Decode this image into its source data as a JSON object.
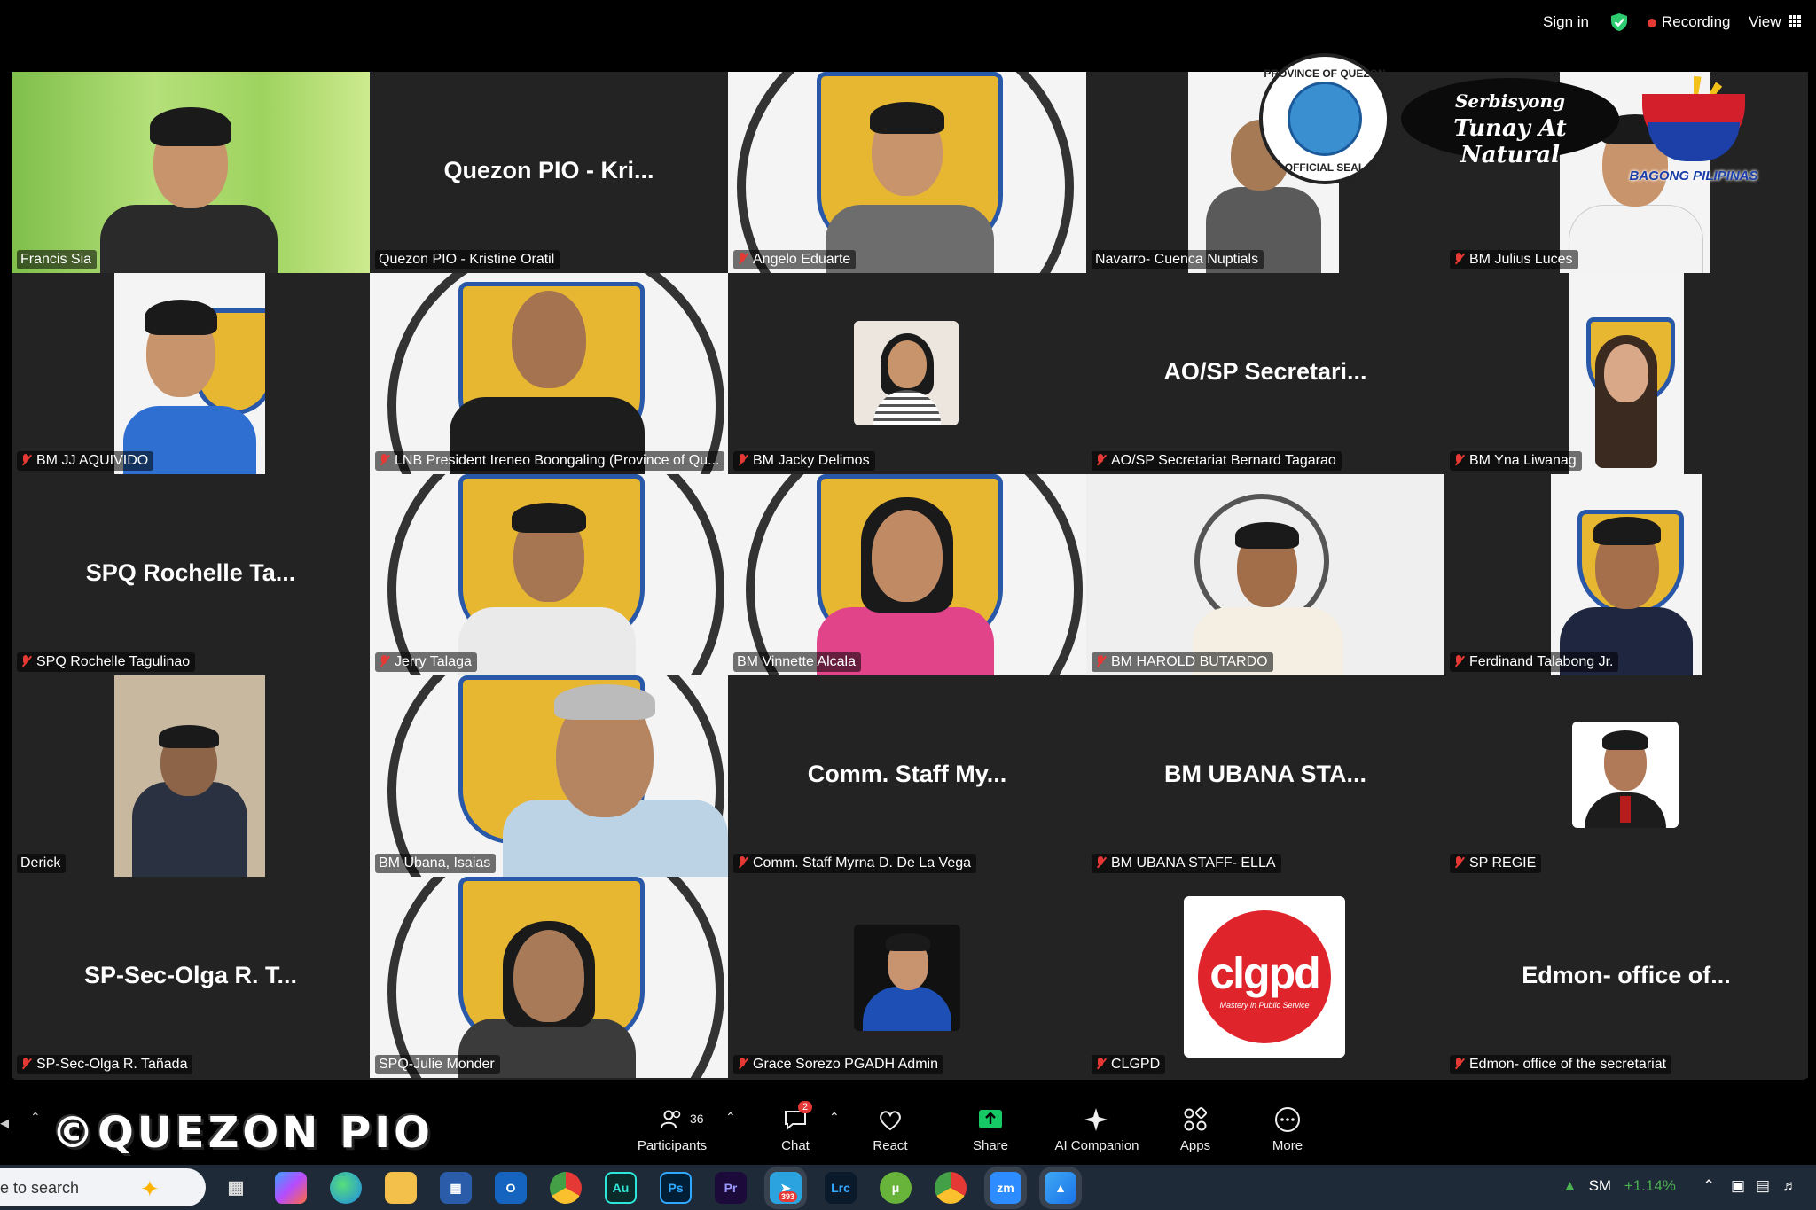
{
  "topbar": {
    "sign_in": "Sign in",
    "recording": "Recording",
    "view": "View"
  },
  "tiles": [
    {
      "label": "Francis Sia",
      "muted": false,
      "display": "video"
    },
    {
      "label": "Quezon PIO - Kristine Oratil",
      "big_name": "Quezon PIO - Kri...",
      "muted": false,
      "display": "name"
    },
    {
      "label": "Angelo Eduarte",
      "muted": true,
      "display": "video"
    },
    {
      "label": "Navarro- Cuenca Nuptials",
      "muted": false,
      "display": "video"
    },
    {
      "label": "BM Julius Luces",
      "muted": true,
      "display": "video"
    },
    {
      "label": "BM JJ AQUIVIDO",
      "muted": true,
      "display": "video"
    },
    {
      "label": "LNB President Ireneo Boongaling (Province of Qu...",
      "muted": true,
      "display": "video"
    },
    {
      "label": "BM Jacky Delimos",
      "muted": true,
      "display": "avatar"
    },
    {
      "label": "AO/SP Secretariat  Bernard Tagarao",
      "big_name": "AO/SP Secretari...",
      "muted": true,
      "display": "name"
    },
    {
      "label": "BM Yna Liwanag",
      "muted": true,
      "display": "video"
    },
    {
      "label": "SPQ Rochelle Tagulinao",
      "big_name": "SPQ Rochelle Ta...",
      "muted": true,
      "display": "name"
    },
    {
      "label": "Jerry Talaga",
      "muted": true,
      "display": "video"
    },
    {
      "label": "BM Vinnette Alcala",
      "muted": false,
      "display": "video"
    },
    {
      "label": "BM HAROLD BUTARDO",
      "muted": true,
      "display": "video"
    },
    {
      "label": "Ferdinand Talabong Jr.",
      "muted": true,
      "display": "video"
    },
    {
      "label": "Derick",
      "muted": false,
      "display": "video"
    },
    {
      "label": "BM Ubana, Isaias",
      "muted": false,
      "display": "video"
    },
    {
      "label": "Comm. Staff Myrna D. De La Vega",
      "big_name": "Comm. Staff My...",
      "muted": true,
      "display": "name"
    },
    {
      "label": "BM UBANA STAFF- ELLA",
      "big_name": "BM UBANA STA...",
      "muted": true,
      "display": "name"
    },
    {
      "label": "SP REGIE",
      "muted": true,
      "display": "avatar"
    },
    {
      "label": "SP-Sec-Olga R. Tañada",
      "big_name": "SP-Sec-Olga R. T...",
      "muted": true,
      "display": "name"
    },
    {
      "label": "SPQ-Julie Monder",
      "muted": false,
      "display": "video"
    },
    {
      "label": "Grace Sorezo PGADH Admin",
      "muted": true,
      "display": "avatar"
    },
    {
      "label": "CLGPD",
      "muted": true,
      "display": "logo"
    },
    {
      "label": "Edmon- office of the secretariat",
      "big_name": "Edmon- office of...",
      "muted": true,
      "display": "name"
    }
  ],
  "overlays": {
    "seal_top": "PROVINCE OF QUEZON",
    "seal_bottom": "OFFICIAL SEAL",
    "tagline_line1": "Serbisyong",
    "tagline_line2": "Tunay At Natural",
    "bagong_pilipinas": "BAGONG PILIPINAS",
    "clgpd_logo": "clgpd",
    "clgpd_tagline": "Mastery in Public Service"
  },
  "toolbar": {
    "participants_label": "Participants",
    "participants_count": "36",
    "chat_label": "Chat",
    "chat_badge": "2",
    "react_label": "React",
    "share_label": "Share",
    "ai_label": "AI Companion",
    "apps_label": "Apps",
    "more_label": "More"
  },
  "watermark": "©QUEZON PIO",
  "taskbar": {
    "search_text": "e to search",
    "telegram_badge": "393",
    "stock_name": "SM",
    "stock_change": "+1.14%"
  },
  "colors": {
    "tile_bg": "#232323",
    "active_border": "#2ecc71",
    "muted_red": "#e53935",
    "share_green": "#17c964",
    "taskbar_bg": "#1e2a38"
  }
}
